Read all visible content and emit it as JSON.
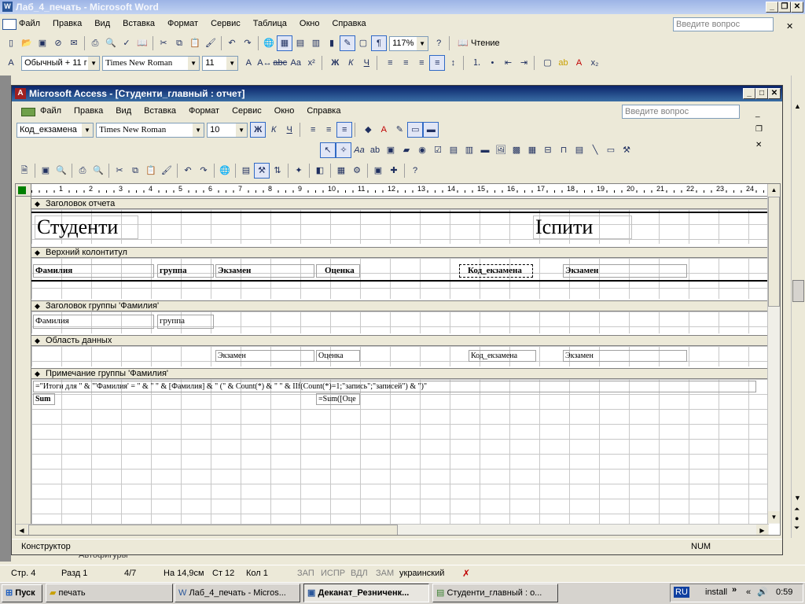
{
  "word": {
    "title": "Лаб_4_печать - Microsoft Word",
    "menu": [
      "Файл",
      "Правка",
      "Вид",
      "Вставка",
      "Формат",
      "Сервис",
      "Таблица",
      "Окно",
      "Справка"
    ],
    "ask_placeholder": "Введите вопрос",
    "zoom": "117%",
    "reading_label": "Чтение",
    "style": "Обычный + 11 г",
    "font": "Times New Roman",
    "size": "11",
    "status": {
      "page": "Стр. 4",
      "section": "Разд 1",
      "pages": "4/7",
      "position": "На 14,9см",
      "line": "Ст 12",
      "col": "Кол 1",
      "rec": "ЗАП",
      "trk": "ИСПР",
      "ext": "ВДЛ",
      "ovr": "ЗАМ",
      "lang": "украинский"
    },
    "drawing_label": "Автофигуры"
  },
  "access": {
    "title": "Microsoft Access - [Студенти_главный : отчет]",
    "menu": [
      "Файл",
      "Правка",
      "Вид",
      "Вставка",
      "Формат",
      "Сервис",
      "Окно",
      "Справка"
    ],
    "ask_placeholder": "Введите вопрос",
    "object_combo": "Код_екзамена",
    "font": "Times New Roman",
    "size": "10",
    "statusbar_mode": "Конструктор",
    "statusbar_num": "NUM"
  },
  "report": {
    "ruler": [
      "1",
      "2",
      "3",
      "4",
      "5",
      "6",
      "7",
      "8",
      "9",
      "10",
      "11",
      "12",
      "13",
      "14",
      "15",
      "16",
      "17",
      "18",
      "19",
      "20",
      "21",
      "22",
      "23",
      "24"
    ],
    "sections": {
      "report_header": "Заголовок отчета",
      "page_header": "Верхний колонтитул",
      "group_header": "Заголовок группы 'Фамилия'",
      "detail": "Область данных",
      "group_footer": "Примечание группы 'Фамилия'"
    },
    "title_left": "Студенти",
    "title_right": "Іспити",
    "page_header_labels": [
      "Фамилия",
      "группа",
      "Экзамен",
      "Оценка",
      "Код_екзамена",
      "Экзамен"
    ],
    "group_header_fields": [
      "Фамилия",
      "группа"
    ],
    "detail_fields": [
      "Экзамен",
      "Оценка",
      "Код_екзамена",
      "Экзамен"
    ],
    "footer_expression": "=\"Итоги для \" & \"'Фамилия' = \" & \" \" & [Фамилия] & \" (\" & Count(*) & \" \" & IIf(Count(*)=1;\"запись\";\"записей\") & \")\"",
    "footer_sum_label": "Sum",
    "footer_sum_expr": "=Sum([Оце"
  },
  "taskbar": {
    "start": "Пуск",
    "tasks": [
      "печать",
      "Лаб_4_печать - Micros...",
      "Деканат_Резниченк...",
      "Студенти_главный : о..."
    ],
    "lang": "RU",
    "install": "install",
    "clock": "0:59"
  }
}
